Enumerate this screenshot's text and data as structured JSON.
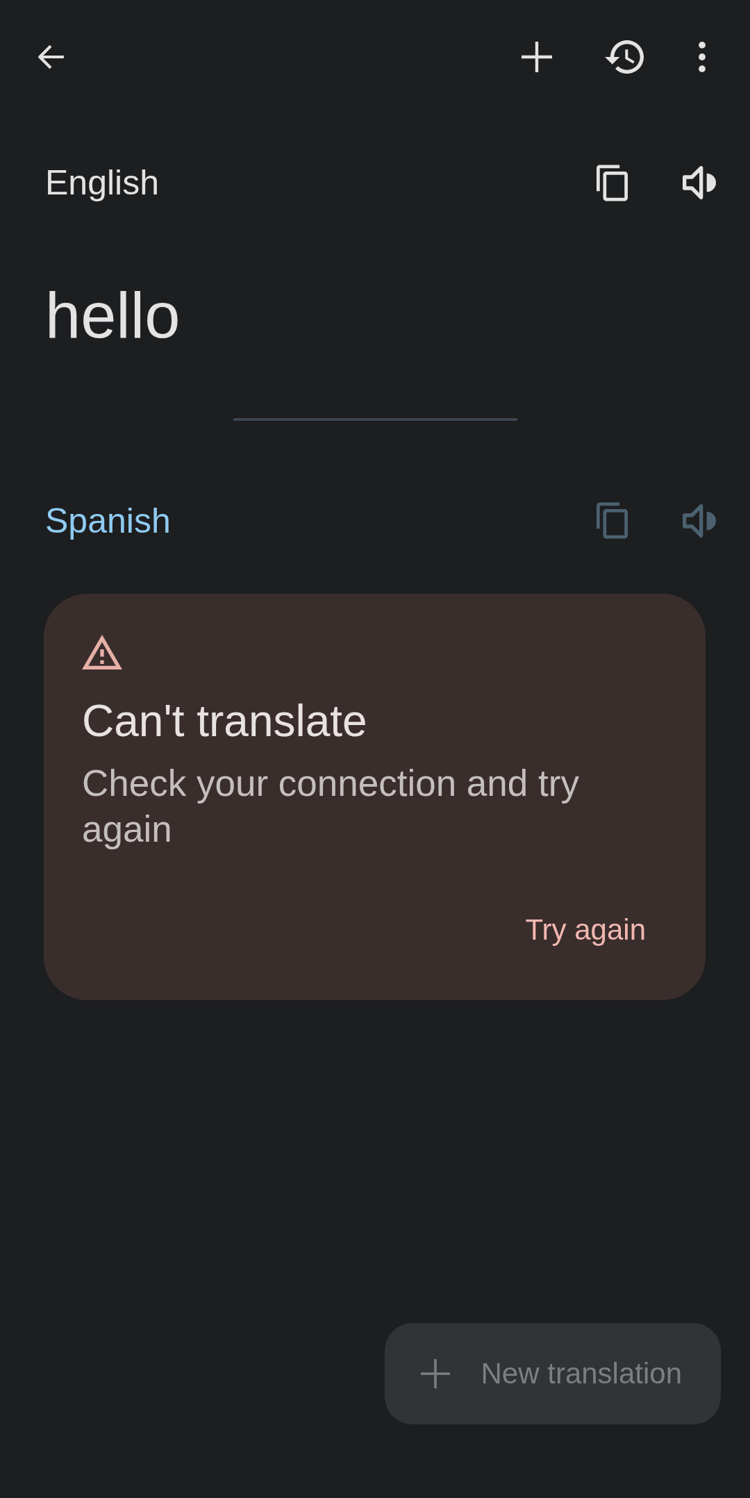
{
  "source": {
    "language": "English",
    "text": "hello",
    "actions": [
      {
        "kind": "copy",
        "disabled": false
      },
      {
        "kind": "listen",
        "disabled": false
      }
    ]
  },
  "target": {
    "language": "Spanish",
    "actions": [
      {
        "kind": "copy",
        "disabled": true
      },
      {
        "kind": "listen",
        "disabled": true
      }
    ]
  },
  "error_card": {
    "title": "Can't translate",
    "message": "Check your connection and try again",
    "action": "Try again"
  },
  "fab": {
    "label": "New translation",
    "disabled": true
  }
}
